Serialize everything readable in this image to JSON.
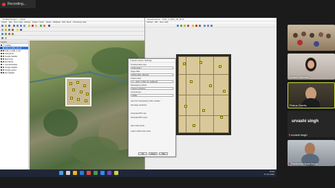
{
  "recording": {
    "label": "Recording..."
  },
  "qgis_left": {
    "title": "*Untitled Project — QGIS",
    "menus": [
      "Project",
      "Edit",
      "View",
      "Layer",
      "Settings",
      "Plugins",
      "Vector",
      "Raster",
      "Database",
      "Web",
      "Mesh",
      "Processing",
      "Help"
    ],
    "layers_title": "Layers",
    "layers": [
      {
        "name": "Untitled",
        "color": "#f4e01b"
      },
      {
        "name": "KUR_3_0051_00_00",
        "color": "#f4e01b",
        "selected": true
      },
      {
        "name": "KUR_3_0051_0_00",
        "color": "#7a5a2a"
      },
      {
        "name": "Orthophoto",
        "color": "#3a8a3a"
      },
      {
        "name": "Google Satellite",
        "color": "#6a8a4a"
      },
      {
        "name": "Bing Aerial",
        "color": "#5a7a5a"
      },
      {
        "name": "Esri World",
        "color": "#8a6a3a"
      },
      {
        "name": "OpenStreetMap",
        "color": "#a8c8e8"
      },
      {
        "name": "Google Satellite",
        "color": "#6a8a4a"
      },
      {
        "name": "Google Hybrid",
        "color": "#6a8a4a"
      },
      {
        "name": "Esri Satellite",
        "color": "#4a6a4a"
      }
    ],
    "status": {
      "coordinate": "Coordinate 21.1573,44.5423",
      "scale": "Scale 1:493,759",
      "magnifier": "Magnifier 100%",
      "rotation": "Rotation 0.0°",
      "render": "Render",
      "crs": "EPSG:4326"
    }
  },
  "dialog": {
    "title": "Transformation Settings",
    "fields": [
      {
        "label": "Transformation type",
        "value": "Polynomial 1"
      },
      {
        "label": "Target SRS",
        "value": "EPSG:4326 - WGS 84"
      },
      {
        "label": "Output raster",
        "value": "C:/.../KUR_3_0051_00_modified.tif"
      },
      {
        "label": "Resampling method",
        "value": "Nearest neighbour"
      },
      {
        "label": "Compression",
        "value": "NONE"
      }
    ],
    "checks": [
      "Use 0 for transparency when needed",
      "Set target resolution",
      "Generate PDF map",
      "Generate PDF report",
      "Save GCP points",
      "Load in QGIS when done"
    ],
    "ok": "OK",
    "cancel": "Cancel",
    "help": "Help"
  },
  "qgis_right": {
    "title": "Georeferencer - KUR_3_0051_00_00.tif",
    "menus": [
      "Settings",
      "Edit",
      "View",
      "Help"
    ],
    "status": {
      "transform": "Transform: Polynomial 1",
      "mean_error": "Mean error: 0.000",
      "coordinate": "20.3884 / 1023.2404",
      "crs": "None"
    }
  },
  "participants": [
    {
      "name": "",
      "kind": "video-class"
    },
    {
      "name": "Azadeh Vafadari",
      "kind": "video-woman"
    },
    {
      "name": "Petrus Gerrits",
      "kind": "video-man",
      "active": true
    },
    {
      "name": "urvashi singh",
      "kind": "name-only",
      "display": "urvashi singh"
    },
    {
      "name": "Raviendra Nath Singh",
      "kind": "video-man2"
    }
  ],
  "taskbar": {
    "time": "15:28",
    "date": "27-01-2022"
  }
}
